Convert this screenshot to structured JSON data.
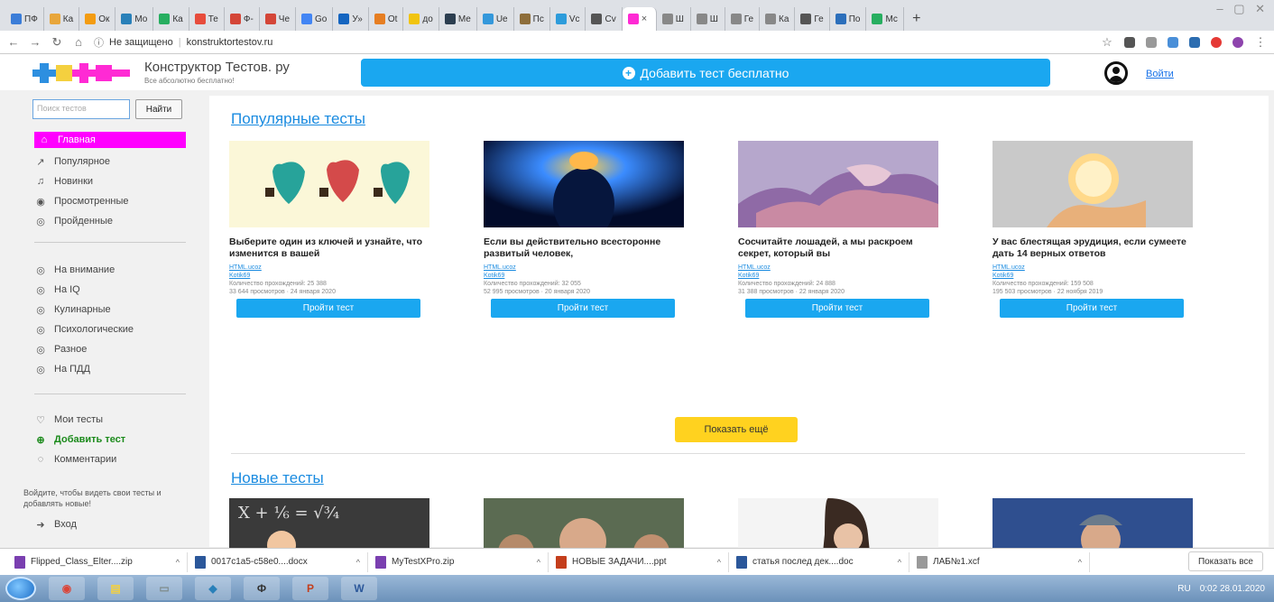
{
  "browser": {
    "tabs": [
      {
        "label": "ПФ",
        "color": "#3b7dd8"
      },
      {
        "label": "Ка",
        "color": "#e8a63b"
      },
      {
        "label": "Ок",
        "color": "#f39c12"
      },
      {
        "label": "Мо",
        "color": "#2980b9"
      },
      {
        "label": "Ка",
        "color": "#27ae60"
      },
      {
        "label": "Те",
        "color": "#e74c3c"
      },
      {
        "label": "Ф-",
        "color": "#d44638"
      },
      {
        "label": "Че",
        "color": "#d44638"
      },
      {
        "label": "Go",
        "color": "#4285f4"
      },
      {
        "label": "У»",
        "color": "#1565c0"
      },
      {
        "label": "Ot",
        "color": "#e67e22"
      },
      {
        "label": "до",
        "color": "#f1c40f"
      },
      {
        "label": "Ме",
        "color": "#2c3e50"
      },
      {
        "label": "Ue",
        "color": "#3498db"
      },
      {
        "label": "Пс",
        "color": "#8e6e3b"
      },
      {
        "label": "Vc",
        "color": "#2d9cdb"
      },
      {
        "label": "Cv",
        "color": "#555555"
      }
    ],
    "active_tab_close": "×",
    "tabs_after": [
      {
        "label": "Ш",
        "color": "#888888"
      },
      {
        "label": "Ш",
        "color": "#888888"
      },
      {
        "label": "Ге",
        "color": "#888888"
      },
      {
        "label": "Ка",
        "color": "#888888"
      },
      {
        "label": "Ге",
        "color": "#555555"
      },
      {
        "label": "По",
        "color": "#2c6fbb"
      },
      {
        "label": "Mc",
        "color": "#27ae60"
      }
    ],
    "new_tab": "+",
    "window_controls": "‒ ▢ ✕",
    "security": "Не защищено",
    "url": "konstruktortestov.ru"
  },
  "site": {
    "brand_title": "Конструктор Тестов. ру",
    "brand_sub": "Все абсолютно бесплатно!",
    "add_test": "Добавить тест бесплатно",
    "login": "Войти"
  },
  "sidebar": {
    "search_placeholder": "Поиск тестов",
    "search_button": "Найти",
    "main_menu": [
      {
        "label": "Главная",
        "icon": "home-icon",
        "glyph": "⌂"
      },
      {
        "label": "Популярное",
        "icon": "trending-icon",
        "glyph": "↗"
      },
      {
        "label": "Новинки",
        "icon": "bell-icon",
        "glyph": "♫"
      },
      {
        "label": "Просмотренные",
        "icon": "eye-icon",
        "glyph": "◉"
      },
      {
        "label": "Пройденные",
        "icon": "eye-off-icon",
        "glyph": "◎"
      }
    ],
    "categories": [
      {
        "label": "На внимание",
        "glyph": "◎"
      },
      {
        "label": "На IQ",
        "glyph": "◎"
      },
      {
        "label": "Кулинарные",
        "glyph": "◎"
      },
      {
        "label": "Психологические",
        "glyph": "◎"
      },
      {
        "label": "Разное",
        "glyph": "◎"
      },
      {
        "label": "На ПДД",
        "glyph": "◎"
      }
    ],
    "my_tests": "Мои тесты",
    "add_test": "Добавить тест",
    "comments": "Комментарии",
    "login_note": "Войдите, чтобы видеть свои тесты и добавлять новые!",
    "login": "Вход"
  },
  "main": {
    "popular_title": "Популярные тесты",
    "new_title": "Новые тесты",
    "show_more": "Показать ещё",
    "cards": [
      {
        "title": "Выберите один из ключей и узнайте, что изменится в вашей",
        "meta1": "HTML.ucoz",
        "meta2": "Kotik69",
        "meta3": "Количество прохождений: 25 388",
        "meta4": "33 644 просмотров · 24 января 2020",
        "button": "Пройти тест"
      },
      {
        "title": "Если вы действительно всесторонне развитый человек,",
        "meta1": "HTML.ucoz",
        "meta2": "Kotik69",
        "meta3": "Количество прохождений: 32 055",
        "meta4": "52 995 просмотров · 20 января 2020",
        "button": "Пройти тест"
      },
      {
        "title": "Сосчитайте лошадей, а мы раскроем секрет, который вы",
        "meta1": "HTML.ucoz",
        "meta2": "Kotik69",
        "meta3": "Количество прохождений: 24 888",
        "meta4": "31 388 просмотров · 22 января 2020",
        "button": "Пройти тест"
      },
      {
        "title": "У вас блестящая эрудиция, если сумеете дать 14 верных ответов",
        "meta1": "HTML.ucoz",
        "meta2": "Kotik69",
        "meta3": "Количество прохождений: 159 508",
        "meta4": "195 503 просмотров · 22 ноября 2019",
        "button": "Пройти тест"
      }
    ]
  },
  "downloads": {
    "items": [
      {
        "name": "Flipped_Class_Elter....zip",
        "color": "#7a3fb0"
      },
      {
        "name": "0017c1a5-c58e0....docx",
        "color": "#2b579a"
      },
      {
        "name": "MyTestXPro.zip",
        "color": "#7a3fb0"
      },
      {
        "name": "НОВЫЕ ЗАДАЧИ....ppt",
        "color": "#c43e1c"
      },
      {
        "name": "статья послед дек....doc",
        "color": "#2b579a"
      },
      {
        "name": "ЛАБ№1.xcf",
        "color": "#999999"
      }
    ],
    "show_all": "Показать все"
  },
  "taskbar": {
    "apps": [
      {
        "label": "◉",
        "color": "#db4437"
      },
      {
        "label": "▤",
        "color": "#f4d03f"
      },
      {
        "label": "▭",
        "color": "#7f8c8d"
      },
      {
        "label": "◆",
        "color": "#2980b9"
      },
      {
        "label": "Ф",
        "color": "#333333"
      },
      {
        "label": "P",
        "color": "#c43e1c"
      },
      {
        "label": "W",
        "color": "#2b579a"
      }
    ],
    "lang": "RU",
    "time": "0:02",
    "date": "28.01.2020"
  }
}
